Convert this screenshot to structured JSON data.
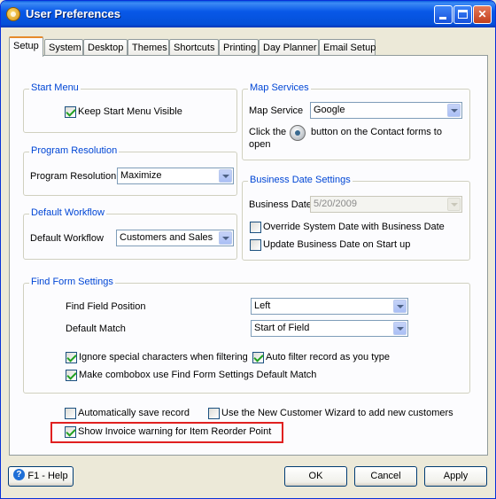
{
  "window": {
    "title": "User Preferences"
  },
  "tabs": [
    "Setup",
    "System",
    "Desktop",
    "Themes",
    "Shortcuts",
    "Printing",
    "Day Planner",
    "Email Setup"
  ],
  "start_menu": {
    "title": "Start Menu",
    "keep_visible_label": "Keep Start Menu Visible",
    "keep_visible_checked": true
  },
  "program_resolution": {
    "title": "Program Resolution",
    "label": "Program Resolution",
    "value": "Maximize"
  },
  "default_workflow": {
    "title": "Default Workflow",
    "label": "Default Workflow",
    "value": "Customers and Sales"
  },
  "map_services": {
    "title": "Map Services",
    "label": "Map Service",
    "value": "Google",
    "hint_before": "Click the",
    "hint_after": "button on the Contact forms to",
    "hint_line2": "open"
  },
  "business_date": {
    "title": "Business Date Settings",
    "label": "Business Date",
    "value": "5/20/2009",
    "override_label": "Override System Date with Business Date",
    "override_checked": false,
    "update_label": "Update Business Date on Start up",
    "update_checked": false
  },
  "find_form": {
    "title": "Find Form Settings",
    "position_label": "Find Field Position",
    "position_value": "Left",
    "match_label": "Default Match",
    "match_value": "Start of Field",
    "ignore_label": "Ignore special characters when filtering",
    "ignore_checked": true,
    "auto_filter_label": "Auto filter record as you type",
    "auto_filter_checked": true,
    "combobox_label": "Make combobox use Find Form Settings Default Match",
    "combobox_checked": true
  },
  "misc": {
    "auto_save_label": "Automatically save record",
    "auto_save_checked": false,
    "new_customer_label": "Use the New Customer Wizard to add new customers",
    "new_customer_checked": false,
    "invoice_warning_label": "Show Invoice warning for Item Reorder Point",
    "invoice_warning_checked": true
  },
  "buttons": {
    "help": "F1 - Help",
    "ok": "OK",
    "cancel": "Cancel",
    "apply": "Apply"
  }
}
